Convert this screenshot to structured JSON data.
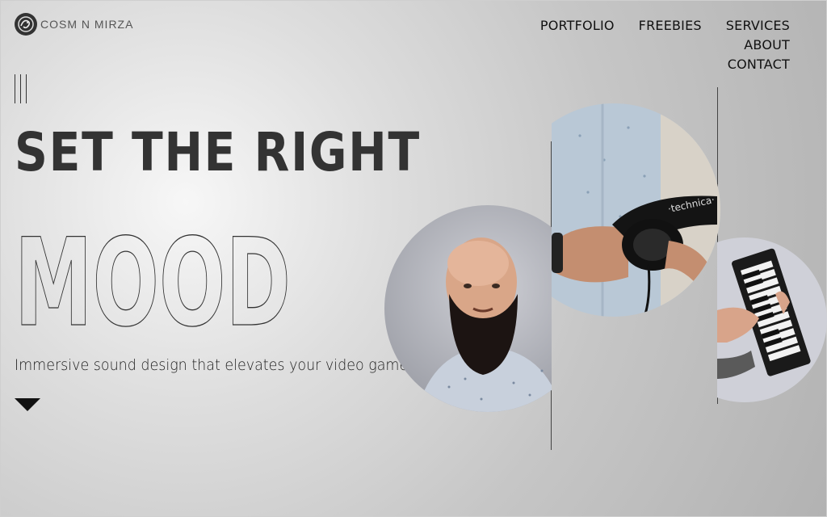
{
  "brand": {
    "name": "COSM N MIRZA",
    "logo_icon": "dragon-logo-icon"
  },
  "nav": {
    "items": [
      {
        "label": "PORTFOLIO"
      },
      {
        "label": "FREEBIES"
      },
      {
        "label": "SERVICES"
      },
      {
        "label": "ABOUT"
      },
      {
        "label": "CONTACT"
      }
    ]
  },
  "hero": {
    "headline": "SET THE RIGHT",
    "outline_word": "MOOD",
    "subtitle": "Immersive sound design that elevates your video game",
    "scroll_icon": "triangle-down-icon"
  },
  "photos": [
    {
      "name": "portrait-photo",
      "desc": "bearded-man-portrait"
    },
    {
      "name": "headphones-photo",
      "desc": "hands-holding-headphones"
    },
    {
      "name": "keyboard-photo",
      "desc": "hands-on-midi-keyboard"
    }
  ],
  "colors": {
    "text": "#111111",
    "headline": "#333333",
    "background": "#c8c8c8"
  }
}
